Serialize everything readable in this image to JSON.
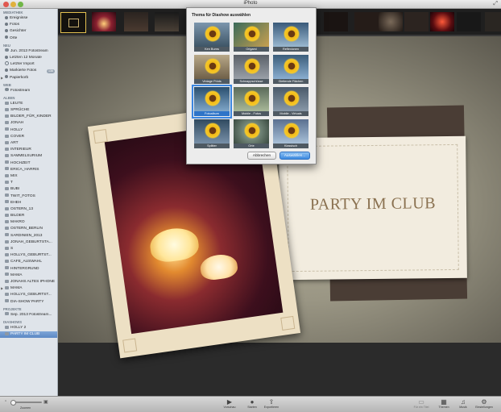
{
  "window": {
    "title": "iPhoto"
  },
  "sidebar": {
    "sections": [
      {
        "title": "MEDIATHEK",
        "items": [
          {
            "label": "Ereignisse",
            "icon": "events-icon"
          },
          {
            "label": "Fotos",
            "icon": "photos-icon"
          },
          {
            "label": "Gesichter",
            "icon": "faces-icon"
          },
          {
            "label": "Orte",
            "icon": "places-icon"
          }
        ]
      },
      {
        "title": "NEU",
        "items": [
          {
            "label": "Jun. 2013 Fotostream",
            "icon": "photostream-icon"
          },
          {
            "label": "Letzten 12 Monate",
            "icon": "calendar-icon"
          },
          {
            "label": "Letzter Import",
            "icon": "clock-icon"
          },
          {
            "label": "Markierte Fotos",
            "icon": "flag-icon",
            "badge": "136"
          },
          {
            "label": "Papierkorb",
            "icon": "trash-icon"
          }
        ]
      },
      {
        "title": "WEB",
        "items": [
          {
            "label": "Fotostream",
            "icon": "photostream-icon"
          }
        ]
      },
      {
        "title": "ALBEN",
        "items": [
          {
            "label": "LEUTE"
          },
          {
            "label": "SPRÜCHE"
          },
          {
            "label": "BILDER_FÜR_KINDER"
          },
          {
            "label": "JONAH"
          },
          {
            "label": "HOLLY"
          },
          {
            "label": "COVER"
          },
          {
            "label": "ART"
          },
          {
            "label": "INTERIEUR"
          },
          {
            "label": "SAMMELSURIUM"
          },
          {
            "label": "HOCHZEIT"
          },
          {
            "label": "ERICA_HARRIS"
          },
          {
            "label": "MIX"
          },
          {
            "label": "T"
          },
          {
            "label": "BUBI"
          },
          {
            "label": "TWIT_FOTOS"
          },
          {
            "label": "EHEH"
          },
          {
            "label": "OSTERN_13"
          },
          {
            "label": "BILDER"
          },
          {
            "label": "MAKRO"
          },
          {
            "label": "OSTERN_BERLIN"
          },
          {
            "label": "SARDINIEN_2013"
          },
          {
            "label": "JONAH_GEBURTSTA..."
          },
          {
            "label": "S"
          },
          {
            "label": "HOLLYS_GEBURTST..."
          },
          {
            "label": "CAFE_AUSWAHL"
          },
          {
            "label": "HINTERGRUND"
          },
          {
            "label": "MAMA"
          },
          {
            "label": "JONAHS ALTES IPHONE"
          },
          {
            "label": "MAMA"
          },
          {
            "label": "HOLLYS_GEBURTST..."
          },
          {
            "label": "DIA-SHOW PARTY"
          }
        ]
      },
      {
        "title": "PROJEKTE",
        "items": [
          {
            "label": "Sep. 2013 Fotostream..."
          }
        ]
      },
      {
        "title": "DIASHOWS",
        "items": [
          {
            "label": "HOLLY 2"
          },
          {
            "label": "PARTY IM CLUB"
          }
        ]
      }
    ]
  },
  "slide": {
    "text": "PARTY IM CLUB"
  },
  "dialog": {
    "title": "Thema für Diashow auswählen",
    "themes": [
      "Ken Burns",
      "Origami",
      "Reflexionen",
      "Vintage Prints",
      "Schnappschüsse",
      "Gleitende Flächen",
      "Fotoalbum",
      "Mobile - Fotos",
      "Mobile - Virtuals",
      "Splitter",
      "Orte",
      "Klassisch"
    ],
    "selected": "Fotoalbum",
    "cancel_label": "Abbrechen",
    "ok_label": "Auswählen..."
  },
  "toolbar": {
    "zoom_label": "Zoomen",
    "buttons": [
      {
        "label": "Vorschau",
        "icon": "preview-icon"
      },
      {
        "label": "Starten",
        "icon": "play-icon"
      },
      {
        "label": "Exportieren",
        "icon": "export-icon"
      },
      {
        "label": "Für ein Titel",
        "icon": "title-icon"
      },
      {
        "label": "Themen",
        "icon": "themes-icon"
      },
      {
        "label": "Musik",
        "icon": "music-icon"
      },
      {
        "label": "Einstellungen",
        "icon": "gear-icon"
      }
    ]
  },
  "colors": {
    "selection": "#5c88c4",
    "accent": "#3b86e0"
  }
}
